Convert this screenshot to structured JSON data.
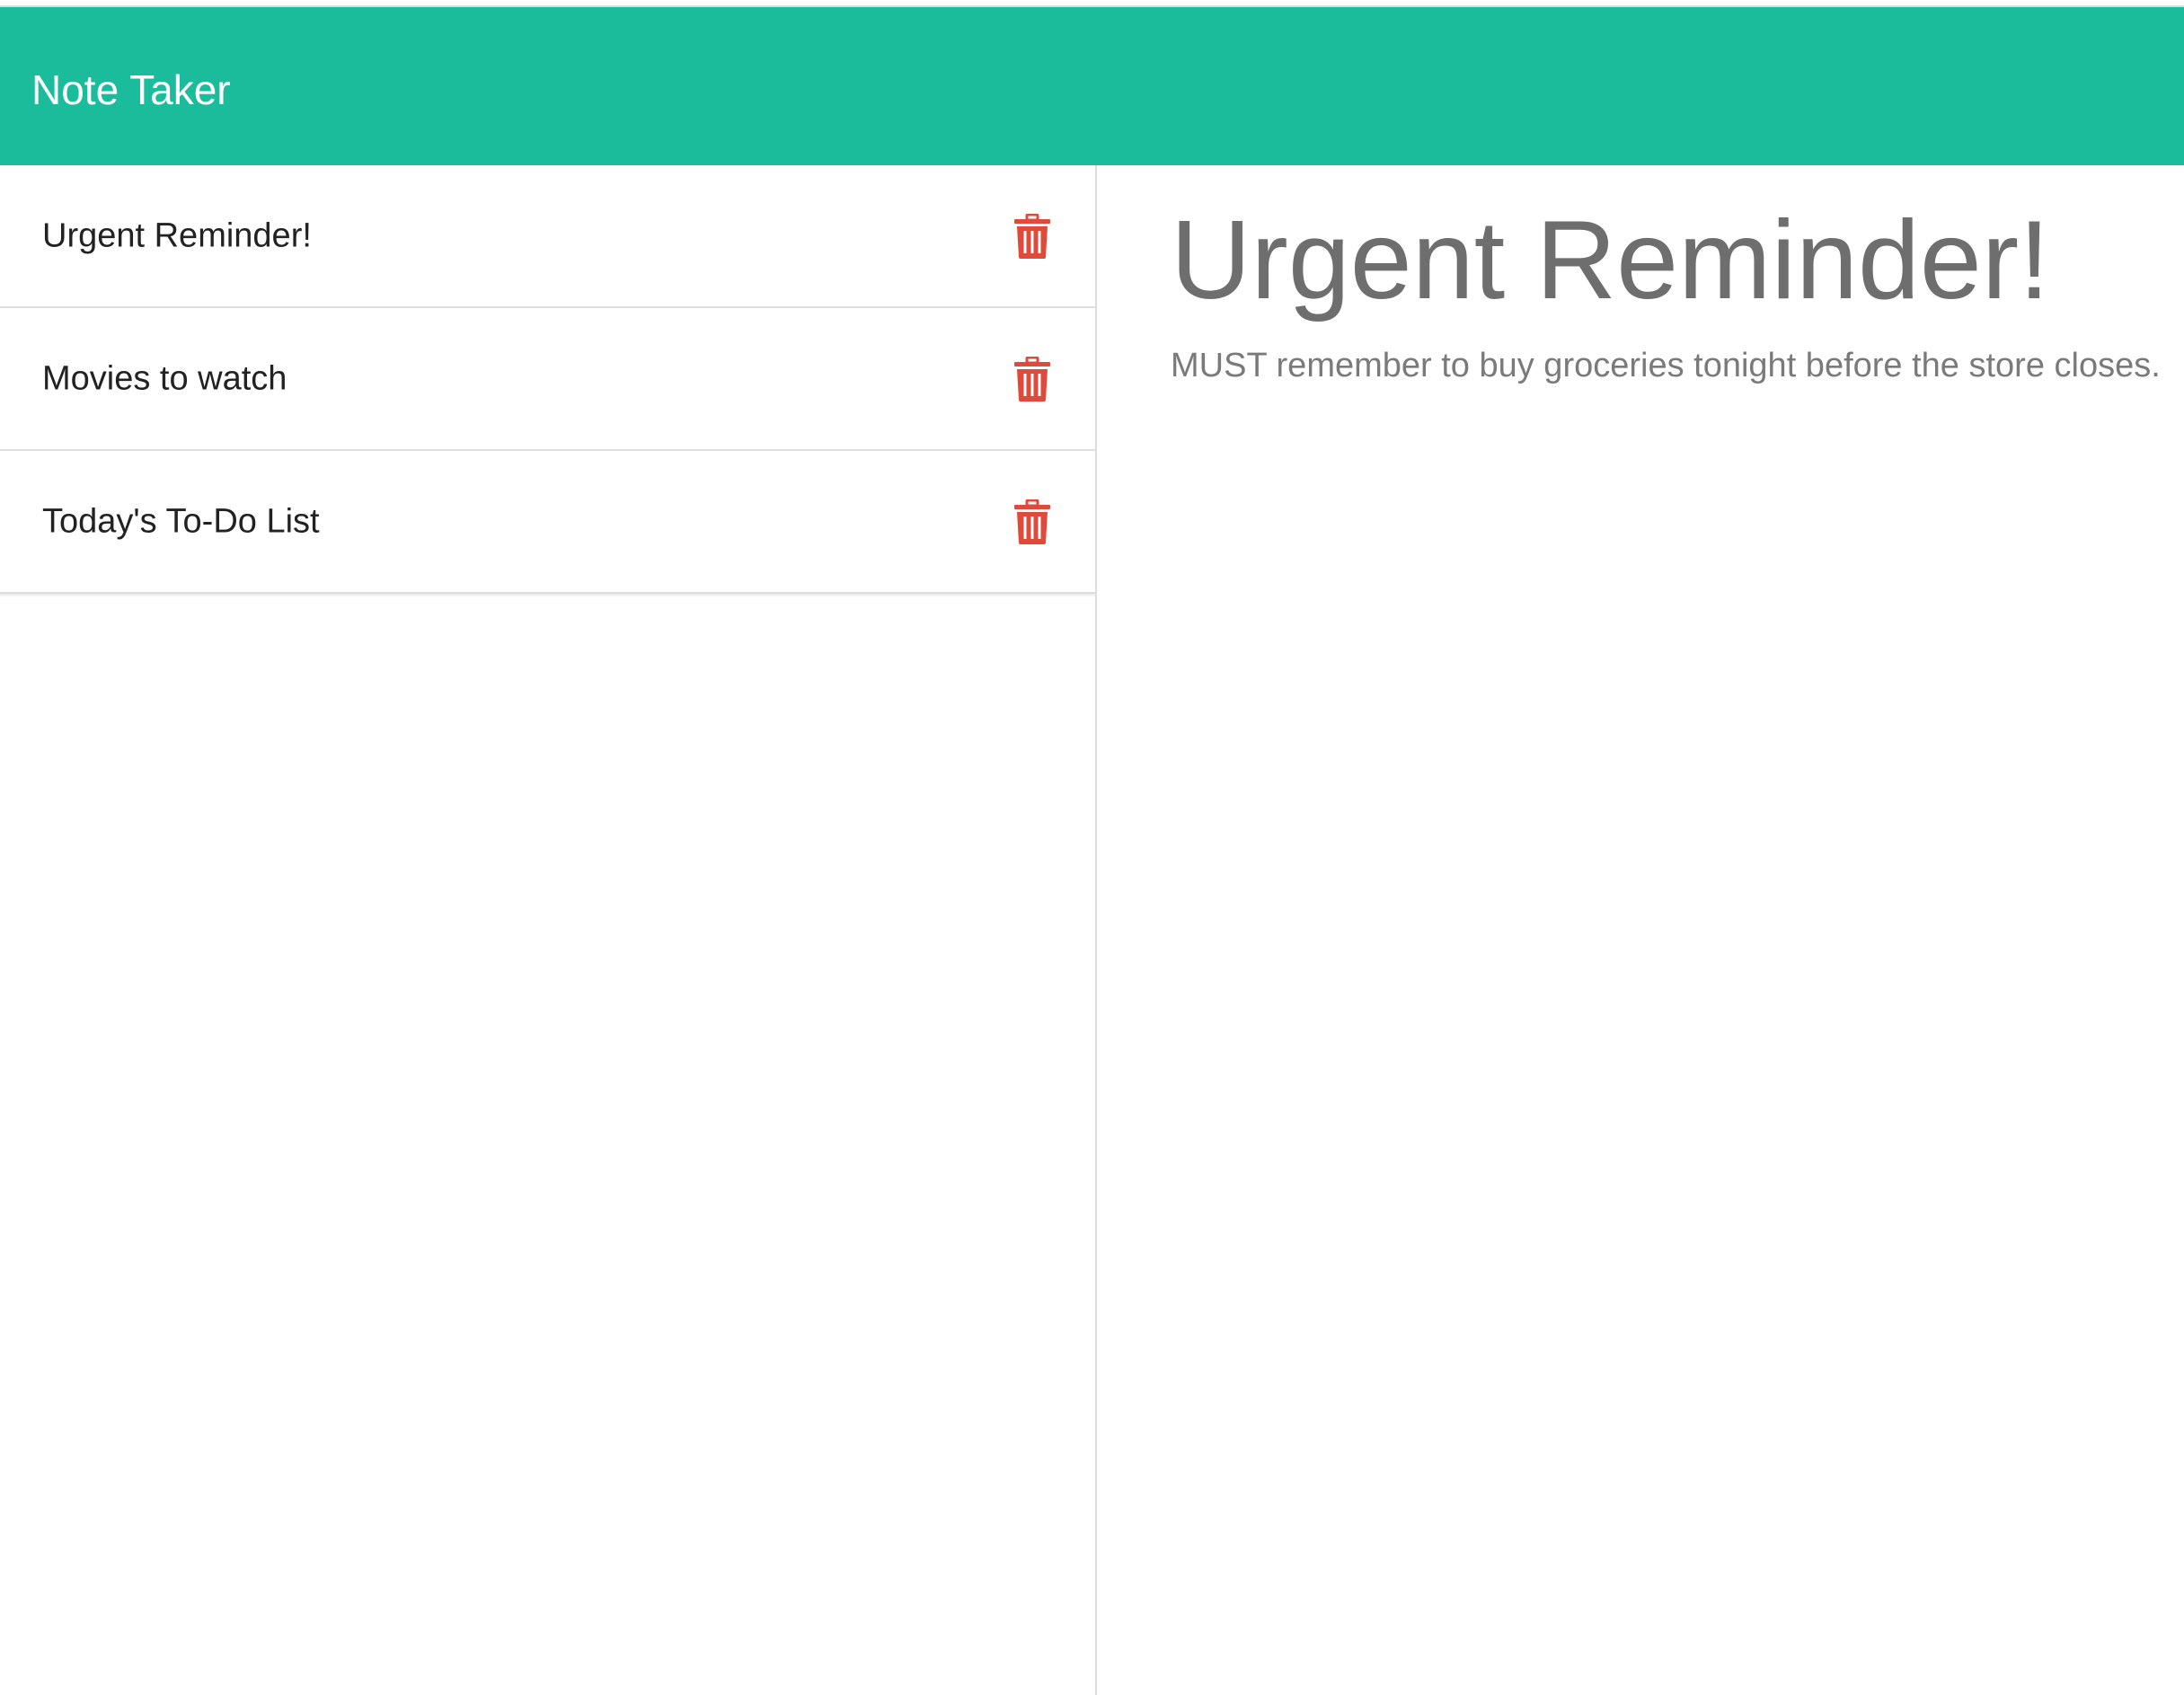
{
  "app": {
    "brand": "Note Taker",
    "accent_color": "#1abc9c",
    "delete_color": "#e04a3a"
  },
  "notes": [
    {
      "title": "Urgent Reminder!",
      "icon": "trash-icon"
    },
    {
      "title": "Movies to watch",
      "icon": "trash-icon"
    },
    {
      "title": "Today's To-Do List",
      "icon": "trash-icon"
    }
  ],
  "active_note": {
    "title": "Urgent Reminder!",
    "text": "MUST remember to buy groceries tonight before the store closes."
  }
}
